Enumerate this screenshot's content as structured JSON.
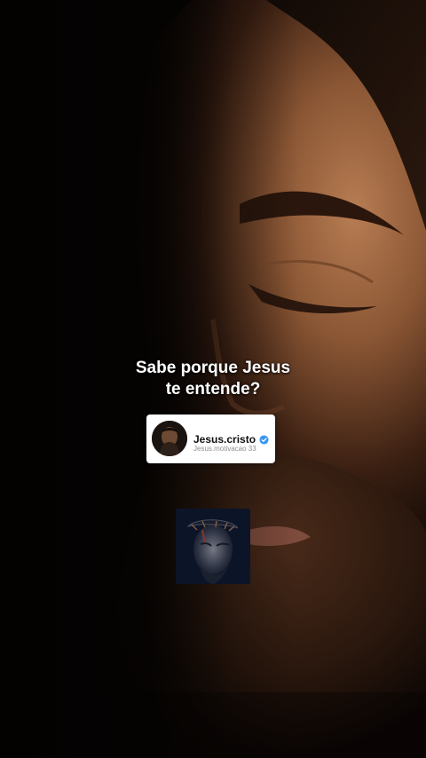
{
  "overlay": {
    "caption_line1": "Sabe porque Jesus",
    "caption_line2": "te entende?"
  },
  "profile_card": {
    "username": "Jesus.cristo",
    "handle": "Jesus.motivacao 33",
    "verified_icon": "verified-badge-icon",
    "verified_color": "#3897f0"
  },
  "colors": {
    "background": "#050302",
    "skin_tone": "#b57c52",
    "caption_text": "#ffffff"
  }
}
